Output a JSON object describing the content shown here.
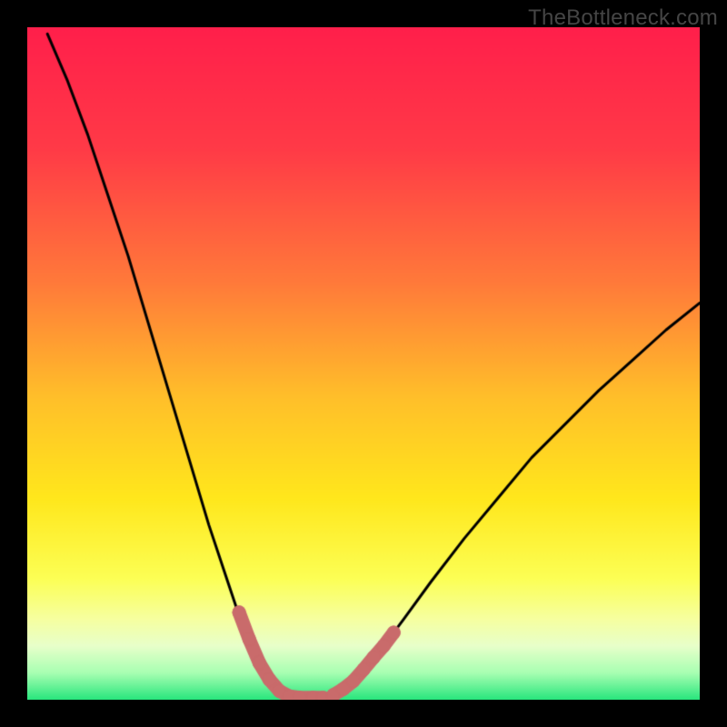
{
  "watermark": "TheBottleneck.com",
  "colors": {
    "frame_bg": "#000000",
    "curve": "#000000",
    "marker": "#c96b6b",
    "gradient_stops": [
      {
        "pos": 0.0,
        "color": "#ff1f4b"
      },
      {
        "pos": 0.18,
        "color": "#ff3a47"
      },
      {
        "pos": 0.38,
        "color": "#ff7a3a"
      },
      {
        "pos": 0.55,
        "color": "#ffbf2a"
      },
      {
        "pos": 0.7,
        "color": "#ffe71c"
      },
      {
        "pos": 0.82,
        "color": "#fcff55"
      },
      {
        "pos": 0.88,
        "color": "#f6ffa0"
      },
      {
        "pos": 0.92,
        "color": "#e8ffca"
      },
      {
        "pos": 0.96,
        "color": "#a8ffb2"
      },
      {
        "pos": 1.0,
        "color": "#28e67d"
      }
    ]
  },
  "chart_data": {
    "type": "line",
    "title": "",
    "xlabel": "",
    "ylabel": "",
    "x_range": [
      0,
      100
    ],
    "y_range": [
      0,
      100
    ],
    "curve_left": [
      {
        "x": 3,
        "y": 99
      },
      {
        "x": 6,
        "y": 92
      },
      {
        "x": 9,
        "y": 84
      },
      {
        "x": 12,
        "y": 75
      },
      {
        "x": 15,
        "y": 66
      },
      {
        "x": 18,
        "y": 56
      },
      {
        "x": 21,
        "y": 46
      },
      {
        "x": 24,
        "y": 36
      },
      {
        "x": 27,
        "y": 26
      },
      {
        "x": 30,
        "y": 17
      },
      {
        "x": 32,
        "y": 11
      },
      {
        "x": 34,
        "y": 6
      },
      {
        "x": 36,
        "y": 2.5
      },
      {
        "x": 38,
        "y": 0.8
      },
      {
        "x": 40,
        "y": 0.3
      }
    ],
    "floor": [
      {
        "x": 40,
        "y": 0.3
      },
      {
        "x": 44,
        "y": 0.3
      }
    ],
    "curve_right": [
      {
        "x": 44,
        "y": 0.3
      },
      {
        "x": 46,
        "y": 0.9
      },
      {
        "x": 48,
        "y": 2.2
      },
      {
        "x": 50,
        "y": 4.5
      },
      {
        "x": 53,
        "y": 8
      },
      {
        "x": 56,
        "y": 12
      },
      {
        "x": 60,
        "y": 17.5
      },
      {
        "x": 65,
        "y": 24
      },
      {
        "x": 70,
        "y": 30
      },
      {
        "x": 75,
        "y": 36
      },
      {
        "x": 80,
        "y": 41
      },
      {
        "x": 85,
        "y": 46
      },
      {
        "x": 90,
        "y": 50.5
      },
      {
        "x": 95,
        "y": 55
      },
      {
        "x": 100,
        "y": 59
      }
    ],
    "marker_left": [
      {
        "x": 31.5,
        "y": 13
      },
      {
        "x": 33.0,
        "y": 9
      },
      {
        "x": 34.5,
        "y": 5.5
      },
      {
        "x": 36.0,
        "y": 3
      },
      {
        "x": 37.5,
        "y": 1.3
      },
      {
        "x": 39.0,
        "y": 0.5
      },
      {
        "x": 40.5,
        "y": 0.3
      },
      {
        "x": 42.5,
        "y": 0.3
      },
      {
        "x": 44.0,
        "y": 0.3
      }
    ],
    "marker_right": [
      {
        "x": 45.5,
        "y": 0.7
      },
      {
        "x": 47.0,
        "y": 1.6
      },
      {
        "x": 48.5,
        "y": 2.8
      },
      {
        "x": 50.0,
        "y": 4.5
      },
      {
        "x": 51.5,
        "y": 6.3
      },
      {
        "x": 53.0,
        "y": 8.0
      },
      {
        "x": 54.5,
        "y": 10.0
      }
    ]
  }
}
